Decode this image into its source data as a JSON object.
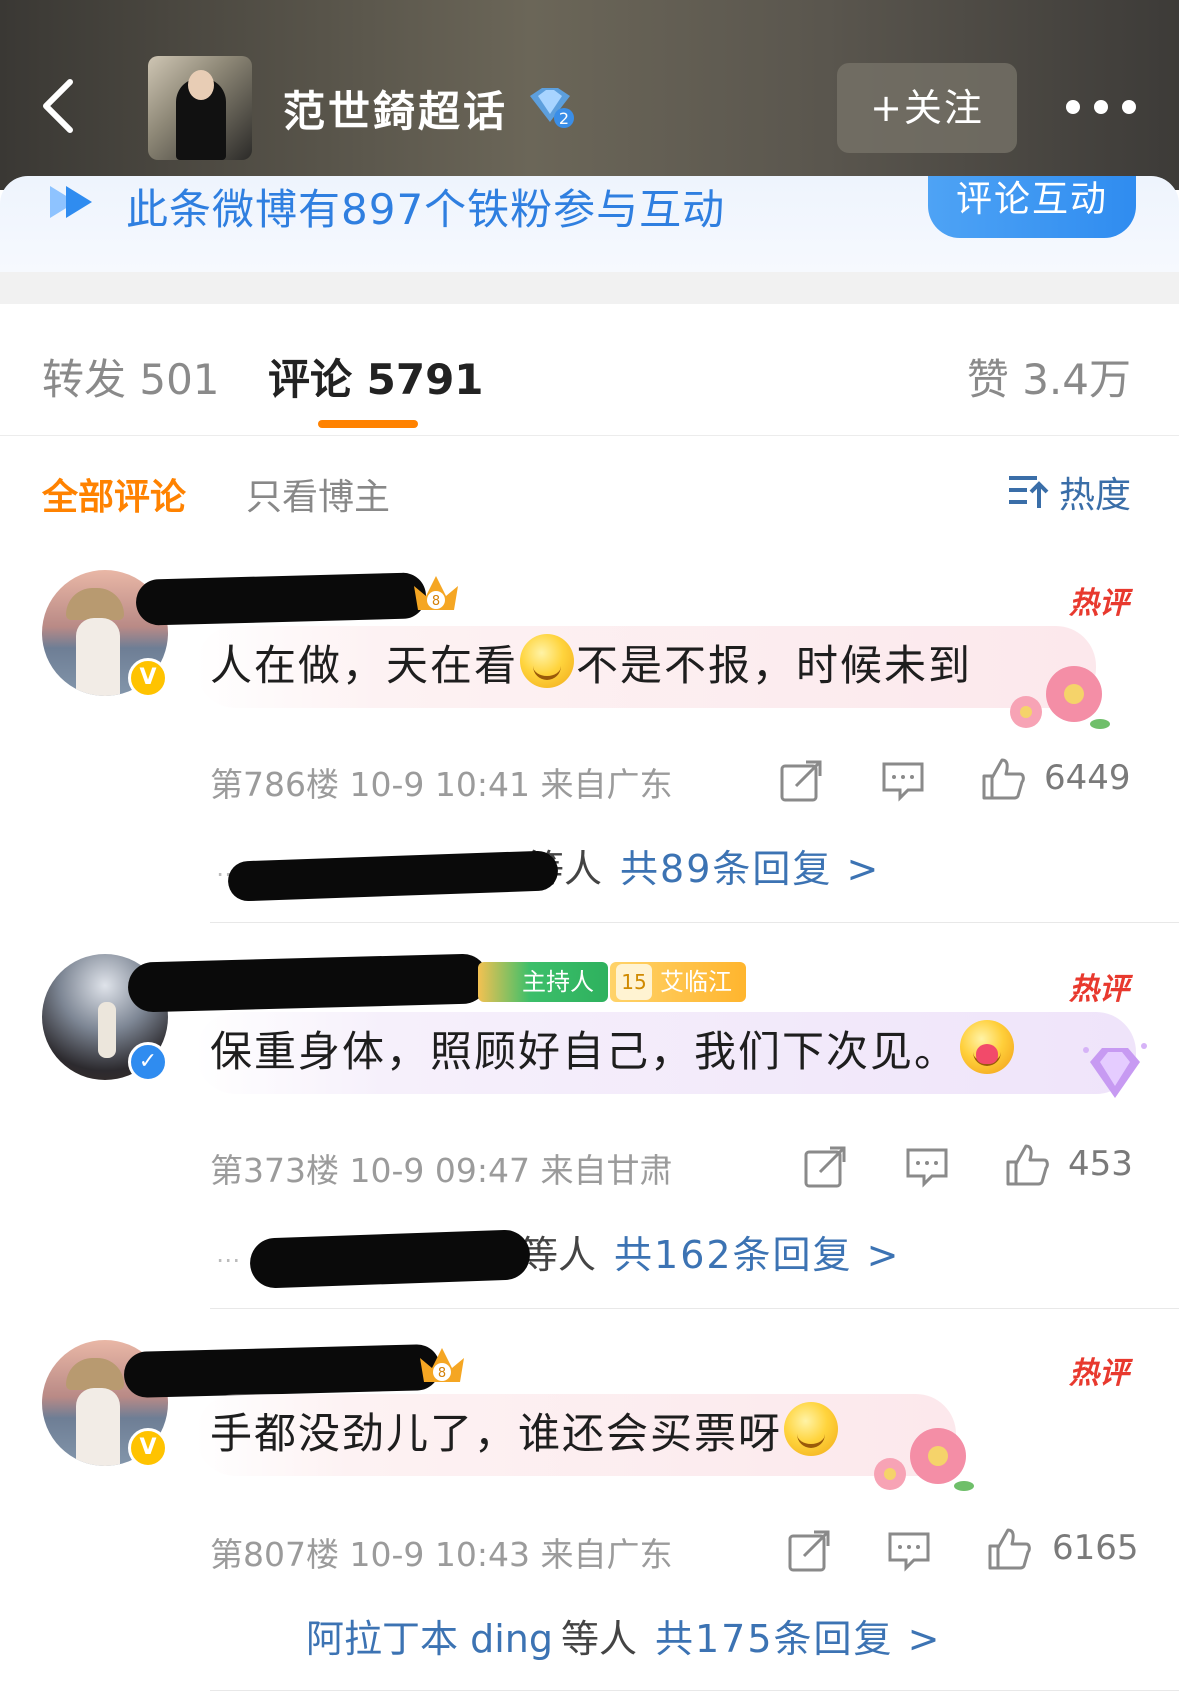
{
  "header": {
    "title": "范世錡超话",
    "follow_label": "+关注",
    "badge_level": "2"
  },
  "banner": {
    "text": "此条微博有897个铁粉参与互动",
    "button": "评论互动"
  },
  "tabs": {
    "repost": "转发 501",
    "comment": "评论 5791",
    "like": "赞 3.4万"
  },
  "filter": {
    "all": "全部评论",
    "blogger": "只看博主",
    "sort": "热度"
  },
  "comments": [
    {
      "text_before": "人在做，天在看",
      "text_after": "不是不报，时候未到",
      "hot_tag": "热评",
      "crown_level": "8",
      "meta": "第786楼  10-9 10:41  来自广东",
      "likes": "6449",
      "reply_suffix": "等人",
      "reply_total": "共89条回复 >"
    },
    {
      "text_before": "保重身体，照顾好自己，我们下次见。",
      "text_after": "",
      "hot_tag": "热评",
      "host_badge": "主持人",
      "level_num": "15",
      "level_badge": "艾临江",
      "meta": "第373楼  10-9 09:47  来自甘肃",
      "likes": "453",
      "reply_suffix": "等人",
      "reply_total": "共162条回复 >"
    },
    {
      "text_before": "手都没劲儿了，谁还会买票呀",
      "text_after": "",
      "hot_tag": "热评",
      "crown_level": "8",
      "meta": "第807楼  10-9 10:43  来自广东",
      "likes": "6165",
      "reply_names": "阿拉丁本 ding",
      "reply_suffix": "等人",
      "reply_total": "共175条回复 >"
    }
  ],
  "colors": {
    "accent_orange": "#ff8200",
    "link_blue": "#3c73b3",
    "banner_blue": "#2f7fe0",
    "hot_red": "#e8392e"
  },
  "icons": {
    "back": "chevron-left-icon",
    "more": "more-dots-icon",
    "share": "share-icon",
    "comment": "comment-icon",
    "like": "thumbs-up-icon",
    "sort": "sort-icon"
  }
}
